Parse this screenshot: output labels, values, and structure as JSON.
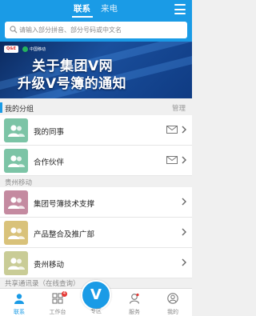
{
  "header": {
    "tabs": [
      {
        "label": "联系",
        "active": true
      },
      {
        "label": "来电",
        "active": false
      }
    ]
  },
  "search": {
    "placeholder": "请输入部分拼音、部分号码或中文名"
  },
  "banner": {
    "logo_left": "Q&E",
    "logo_right": "中国移动",
    "line1": "关于集团V网",
    "line2": "升级V号簿的通知"
  },
  "my_groups": {
    "title": "我的分组",
    "manage_label": "管理",
    "items": [
      {
        "label": "我的同事",
        "color": "#7cc4a6",
        "has_mail": true
      },
      {
        "label": "合作伙伴",
        "color": "#7cc4a6",
        "has_mail": true
      }
    ]
  },
  "guizhou": {
    "title": "贵州移动",
    "items": [
      {
        "label": "集团号簿技术支撑",
        "color": "#c48aa0"
      },
      {
        "label": "产品整合及推广部",
        "color": "#d9c27a"
      },
      {
        "label": "贵州移动",
        "color": "#c9cc96"
      }
    ]
  },
  "shared": {
    "title": "共享通讯录（在线查询）"
  },
  "tabbar": {
    "items": [
      {
        "label": "联系",
        "icon": "person-icon",
        "active": true
      },
      {
        "label": "工作台",
        "icon": "grid-icon",
        "badge": "4"
      },
      {
        "label": "专区",
        "icon": "v-icon",
        "center": "V"
      },
      {
        "label": "服务",
        "icon": "service-icon"
      },
      {
        "label": "我的",
        "icon": "profile-icon"
      }
    ]
  },
  "colors": {
    "primary": "#1a9be6"
  }
}
